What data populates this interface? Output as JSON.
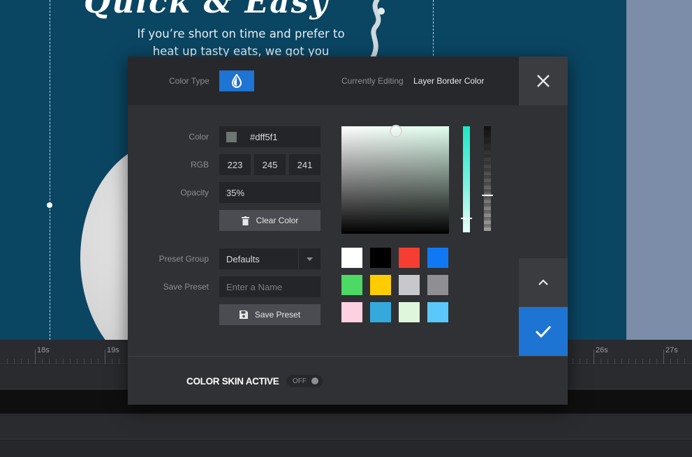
{
  "canvas": {
    "headline": "Quick & Easy",
    "tagline_line1": "If you’re short on time and prefer to",
    "tagline_line2": "heat up tasty eats, we got you",
    "background_color": "#0a4562"
  },
  "timeline": {
    "ticks": [
      "18s",
      "19s",
      "26s",
      "27s"
    ]
  },
  "dialog": {
    "color_type_label": "Color Type",
    "color_type_icon": "drop-icon",
    "currently_editing_label": "Currently Editing",
    "currently_editing_value": "Layer Border Color",
    "close_icon": "close-icon",
    "fields": {
      "color_label": "Color",
      "color_hex": "#dff5f1",
      "rgb_label": "RGB",
      "r": "223",
      "g": "245",
      "b": "241",
      "opacity_label": "Opacity",
      "opacity_value": "35%",
      "clear_color_label": "Clear Color",
      "preset_group_label": "Preset Group",
      "preset_group_value": "Defaults",
      "save_preset_label": "Save Preset",
      "save_preset_placeholder": "Enter a Name",
      "save_preset_button": "Save Preset"
    },
    "picker": {
      "hue": 0.86,
      "alpha": 0.35
    },
    "preset_swatches": [
      "#ffffff",
      "#000000",
      "#f53d31",
      "#1178f3",
      "#4cd964",
      "#ffcc00",
      "#c7c7cc",
      "#8e8e93",
      "#ffd0e0",
      "#34aadc",
      "#dff5dc",
      "#5ac8fa"
    ],
    "footer": {
      "skin_label": "COLOR SKIN ACTIVE",
      "toggle_label": "OFF"
    },
    "accent_color": "#1e74d3"
  }
}
